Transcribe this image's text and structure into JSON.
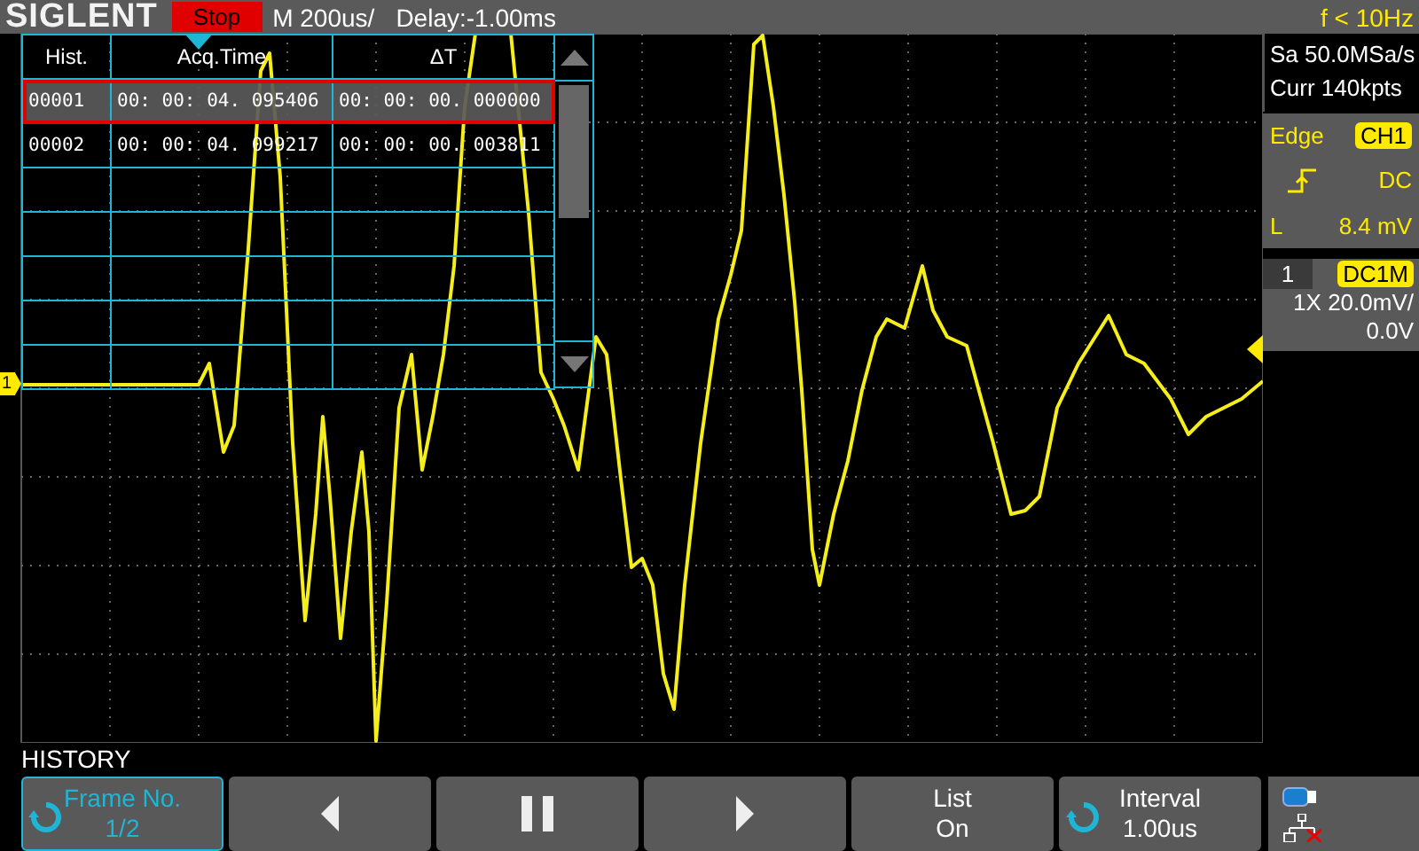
{
  "header": {
    "logo": "SIGLENT",
    "run_state": "Stop",
    "timebase": "M 200us/",
    "delay": "Delay:-1.00ms",
    "frequency": "f < 10Hz"
  },
  "history_table": {
    "columns": [
      "Hist.",
      "Acq.Time",
      "ΔT"
    ],
    "rows": [
      {
        "cells": [
          "00001",
          "00: 00: 04. 095406",
          "00: 00: 00. 000000"
        ],
        "selected": true
      },
      {
        "cells": [
          "00002",
          "00: 00: 04. 099217",
          "00: 00: 00. 003811"
        ],
        "selected": false
      }
    ]
  },
  "channel_marker": "1",
  "acquisition": {
    "sample_rate": "Sa 50.0MSa/s",
    "memory": "Curr 140kpts"
  },
  "trigger": {
    "type": "Edge",
    "source": "CH1",
    "coupling": "DC",
    "level_label": "L",
    "level_value": "8.4 mV"
  },
  "channel": {
    "number": "1",
    "coupling": "DC1M",
    "probe": "1X",
    "scale": "20.0mV/",
    "offset": "0.0V"
  },
  "menu": {
    "title": "HISTORY",
    "softkeys": [
      {
        "kind": "knob",
        "label": "Frame No.",
        "value": "1/2",
        "selected": true
      },
      {
        "kind": "prev",
        "selected": false
      },
      {
        "kind": "pause",
        "selected": false
      },
      {
        "kind": "next",
        "selected": false
      },
      {
        "kind": "text",
        "label": "List",
        "value": "On",
        "selected": false
      },
      {
        "kind": "knob",
        "label": "Interval",
        "value": "1.00us",
        "selected": false
      }
    ]
  }
}
